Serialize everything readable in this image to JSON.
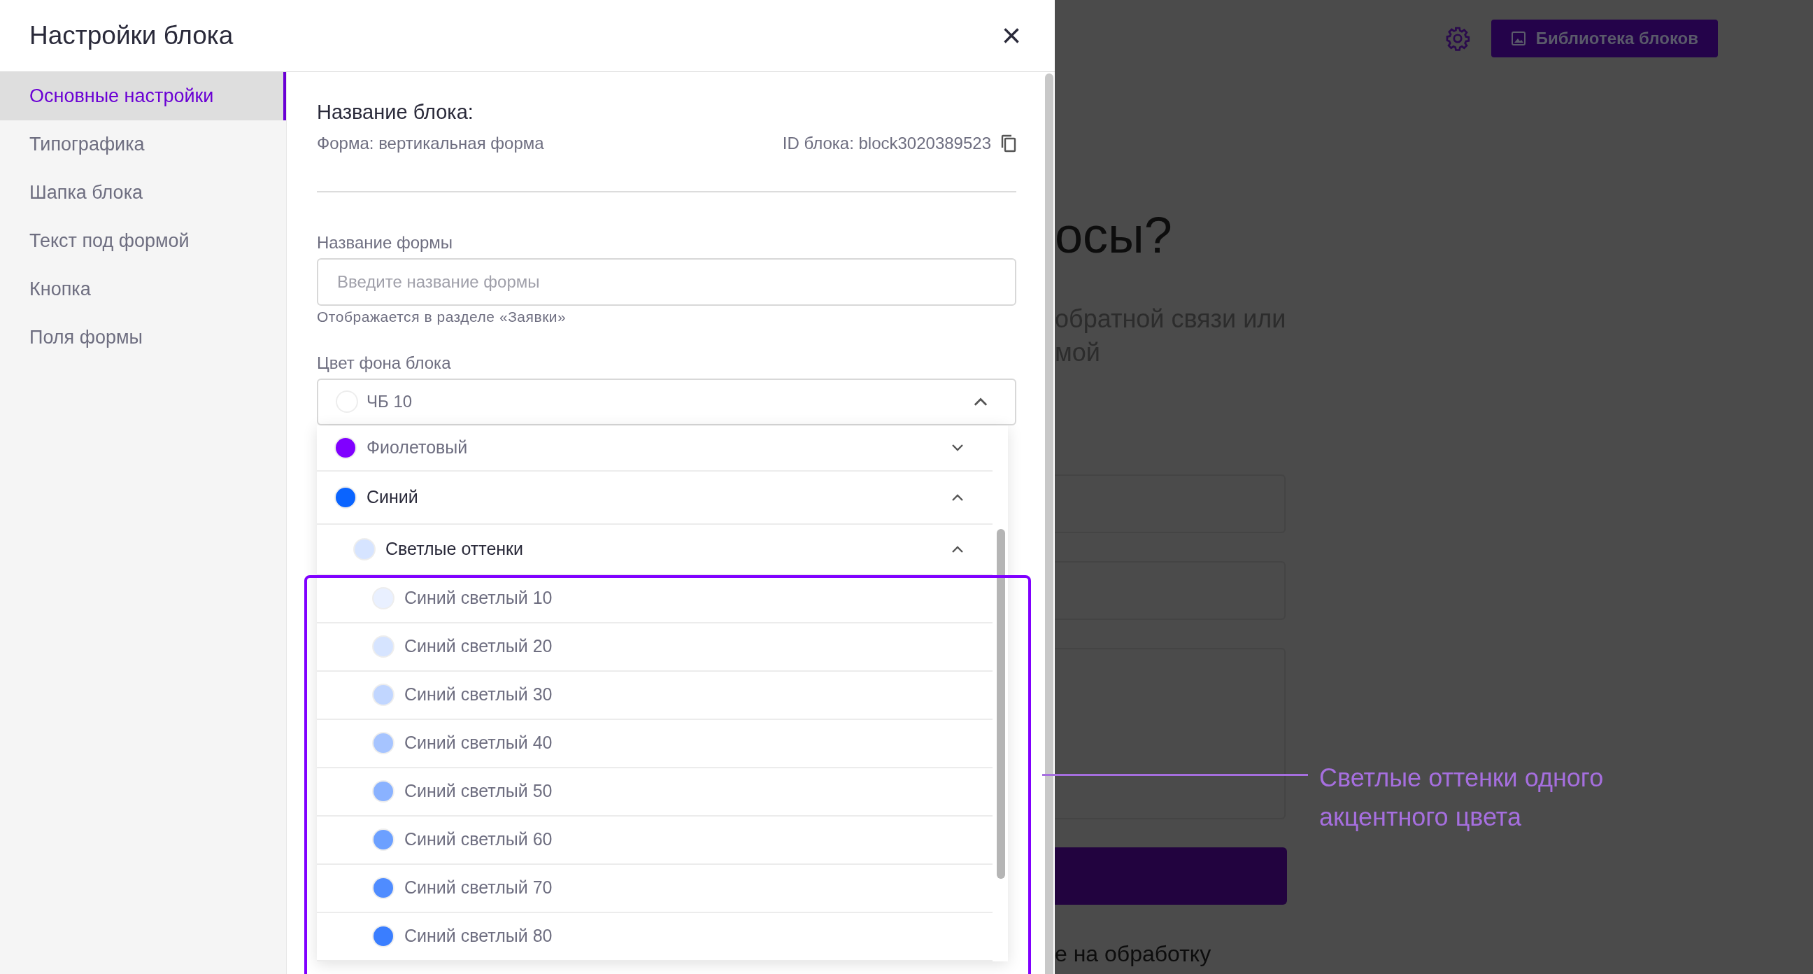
{
  "panel": {
    "title": "Настройки блока",
    "close_icon": "×"
  },
  "sidebar": {
    "items": [
      {
        "label": "Основные настройки",
        "selected": true
      },
      {
        "label": "Типографика",
        "selected": false
      },
      {
        "label": "Шапка блока",
        "selected": false
      },
      {
        "label": "Текст под формой",
        "selected": false
      },
      {
        "label": "Кнопка",
        "selected": false
      },
      {
        "label": "Поля формы",
        "selected": false
      }
    ]
  },
  "block": {
    "heading": "Название блока:",
    "form_type": "Форма: вертикальная форма",
    "block_id": "ID блока: block3020389523"
  },
  "form_name": {
    "label": "Название формы",
    "placeholder": "Введите название формы",
    "hint": "Отображается в разделе «Заявки»"
  },
  "background_color": {
    "label": "Цвет фона блока",
    "value": "ЧБ 10",
    "open": true,
    "options": [
      {
        "label": "Фиолетовый",
        "color": "#8000ff",
        "expanded": false
      },
      {
        "label": "Синий",
        "color": "#0a64ff",
        "expanded": true,
        "children": [
          {
            "label": "Светлые оттенки",
            "color": "#d6e4ff",
            "expanded": true,
            "children": [
              {
                "label": "Синий светлый 10",
                "color": "#e9f0ff"
              },
              {
                "label": "Синий светлый 20",
                "color": "#d6e4ff"
              },
              {
                "label": "Синий светлый 30",
                "color": "#c1d6ff"
              },
              {
                "label": "Синий светлый 40",
                "color": "#a6c4ff"
              },
              {
                "label": "Синий светлый 50",
                "color": "#8ab2ff"
              },
              {
                "label": "Синий светлый 60",
                "color": "#6ca0ff"
              },
              {
                "label": "Синий светлый 70",
                "color": "#4f8cff"
              },
              {
                "label": "Синий светлый 80",
                "color": "#3a7eff"
              }
            ]
          }
        ]
      }
    ]
  },
  "background_page": {
    "library_button": "Библиотека блоков",
    "heading": "осы?",
    "text_lines": [
      "обратной связи или",
      "мой"
    ],
    "consent_text": "е на обработку"
  },
  "annotation": {
    "text": "Светлые оттенки одного акцентного цвета"
  }
}
